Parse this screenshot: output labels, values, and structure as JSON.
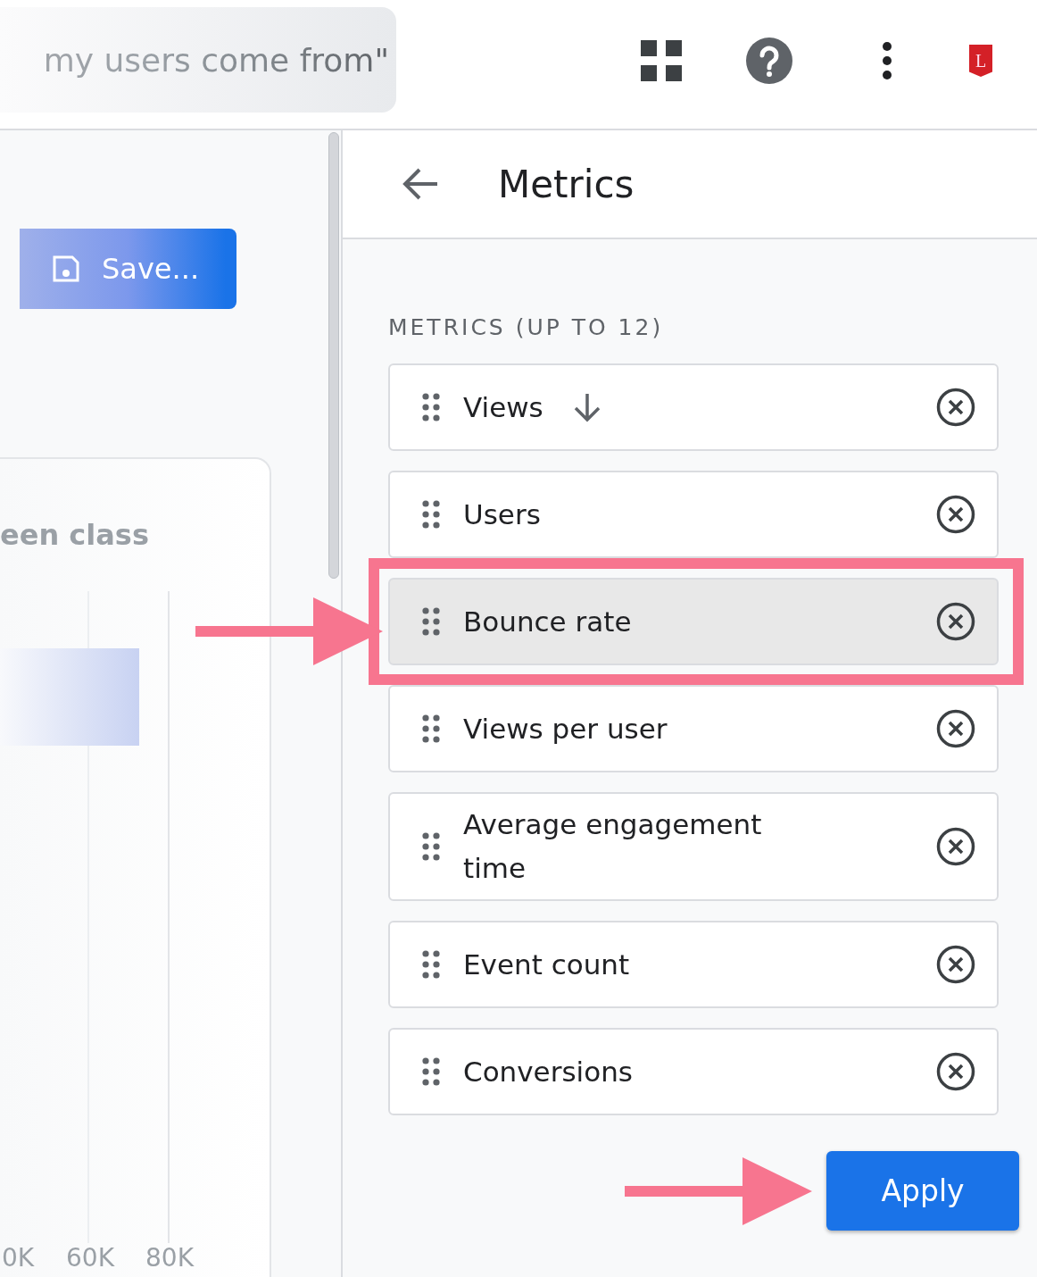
{
  "top_bar": {
    "search_text": "my users come from\"",
    "logo_letter": "L"
  },
  "left_panel": {
    "save_button": "Save...",
    "card_title": "een class",
    "axis_labels": [
      "0K",
      "60K",
      "80K"
    ]
  },
  "metrics_panel": {
    "title": "Metrics",
    "section_label": "METRICS (UP TO 12)",
    "metrics": [
      {
        "label": "Views",
        "sorted": true,
        "selected": false
      },
      {
        "label": "Users",
        "sorted": false,
        "selected": false
      },
      {
        "label": "Bounce rate",
        "sorted": false,
        "selected": true,
        "highlighted": true,
        "arrow": true
      },
      {
        "label": "Views per user",
        "sorted": false,
        "selected": false
      },
      {
        "label": "Average engagement time",
        "sorted": false,
        "selected": false
      },
      {
        "label": "Event count",
        "sorted": false,
        "selected": false
      },
      {
        "label": "Conversions",
        "sorted": false,
        "selected": false
      }
    ],
    "apply_button": "Apply",
    "apply_arrow": true
  }
}
